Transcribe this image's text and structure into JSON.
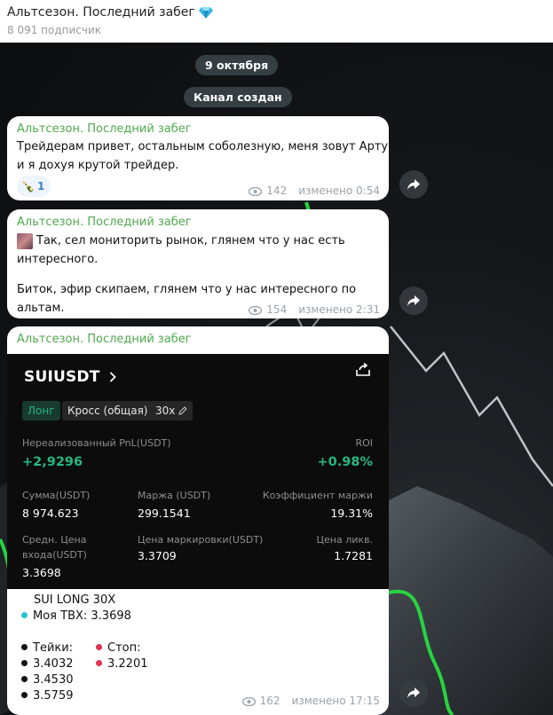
{
  "header": {
    "title": "Альтсезон. Последний забег",
    "subscribers": "8 091 подписчик"
  },
  "service": {
    "date": "9 октября",
    "created": "Канал создан"
  },
  "messages": [
    {
      "author": "Альтсезон. Последний забег",
      "lines": [
        "Трейдерам привет, остальным соболезную, меня зовут Артур",
        "и я дохуя крутой трейдер."
      ],
      "reaction": {
        "emoji": "🍾",
        "count": "1"
      },
      "views": "142",
      "edited": "изменено 0:54"
    },
    {
      "author": "Альтсезон. Последний забег",
      "lines": [
        "Так, сел мониторить рынок, глянем что у нас есть",
        "интересного.",
        "",
        "Биток, эфир скипаем, глянем что у нас интересного по",
        "альтам."
      ],
      "views": "154",
      "edited": "изменено 2:31"
    },
    {
      "author": "Альтсезон. Последний забег",
      "card": {
        "symbol": "SUIUSDT",
        "side": "Лонг",
        "margin_mode": "Кросс (общая)",
        "leverage": "30x",
        "pnl_label": "Нереализованный PnL(USDT)",
        "pnl_value": "+2,9296",
        "roi_label": "ROI",
        "roi_value": "+0.98%",
        "amount_label": "Сумма(USDT)",
        "amount_value": "8 974.623",
        "margin_label": "Маржа (USDT)",
        "margin_value": "299.1541",
        "ratio_label": "Коэффициент маржи",
        "ratio_value": "19.31%",
        "entry_label_1": "Средн. Цена",
        "entry_label_2": "входа(USDT)",
        "entry_value": "3.3698",
        "mark_label": "Цена маркировки(USDT)",
        "mark_value": "3.3709",
        "liq_label": "Цена ликв.",
        "liq_value": "1.7281"
      },
      "summary": {
        "title": "SUI LONG 30X",
        "entry": "Моя ТВХ: 3.3698",
        "takes_label": "Тейки:",
        "takes": [
          "3.4032",
          "3.4530",
          "3.5759"
        ],
        "stop_label": "Стоп:",
        "stop": "3.2201"
      },
      "views": "162",
      "edited": "изменено 17:15"
    }
  ],
  "colors": {
    "author": "#4fa94d",
    "profit": "#24b883",
    "chart_line": "#27d341",
    "take_dot": "#111111",
    "stop_dot": "#e0344f",
    "entry_dot": "#29c3d6"
  },
  "icons": [
    "verified-diamond-icon",
    "eye-icon",
    "share-arrow-icon",
    "chevron-right-icon",
    "share-box-icon",
    "edit-pencil-icon",
    "avatar-icon"
  ]
}
